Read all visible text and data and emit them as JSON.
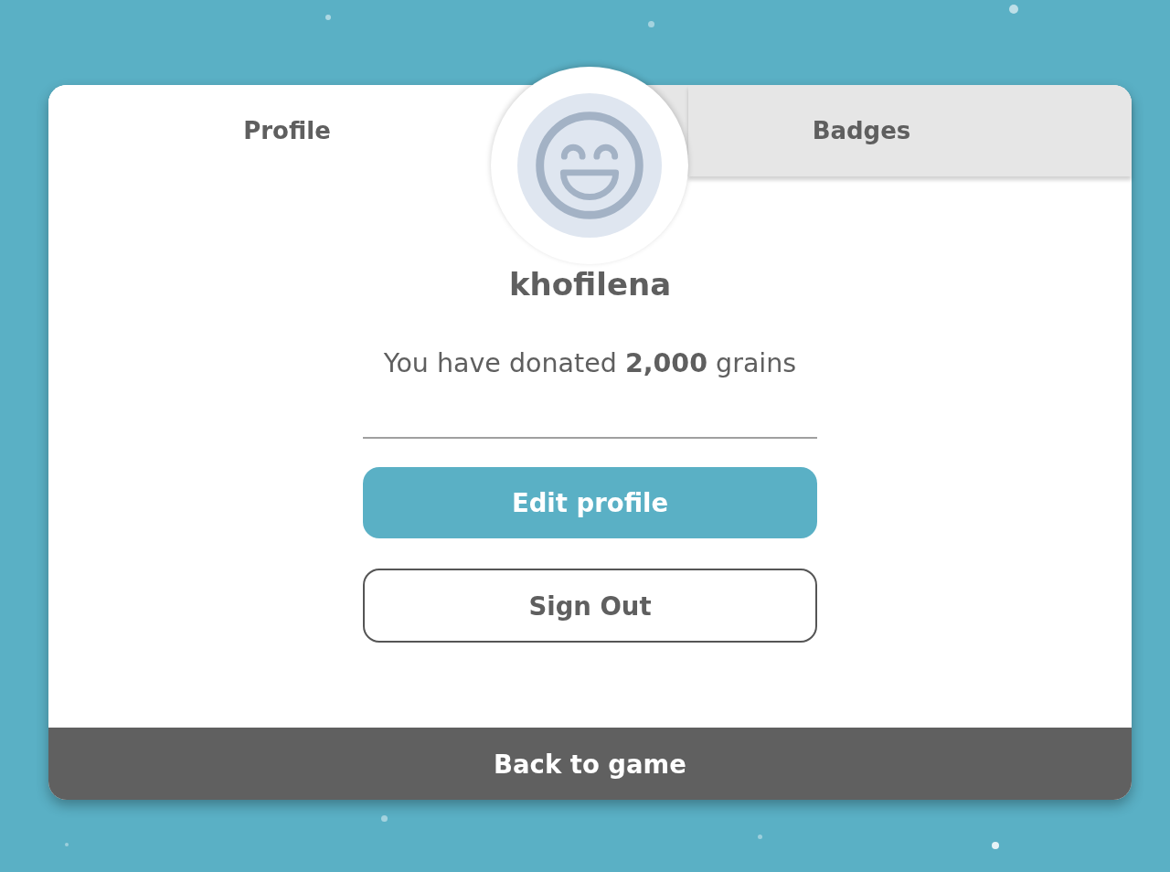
{
  "tabs": [
    {
      "label": "Profile",
      "selected": true
    },
    {
      "label": "Badges",
      "selected": false
    }
  ],
  "profile": {
    "username": "khofilena",
    "donation_text": "You have donated **2,000** grains"
  },
  "buttons": [
    {
      "label": "Edit profile",
      "kind": "primary"
    },
    {
      "label": "Sign Out",
      "kind": "outline"
    }
  ],
  "footer": {
    "label": "Back to game"
  }
}
